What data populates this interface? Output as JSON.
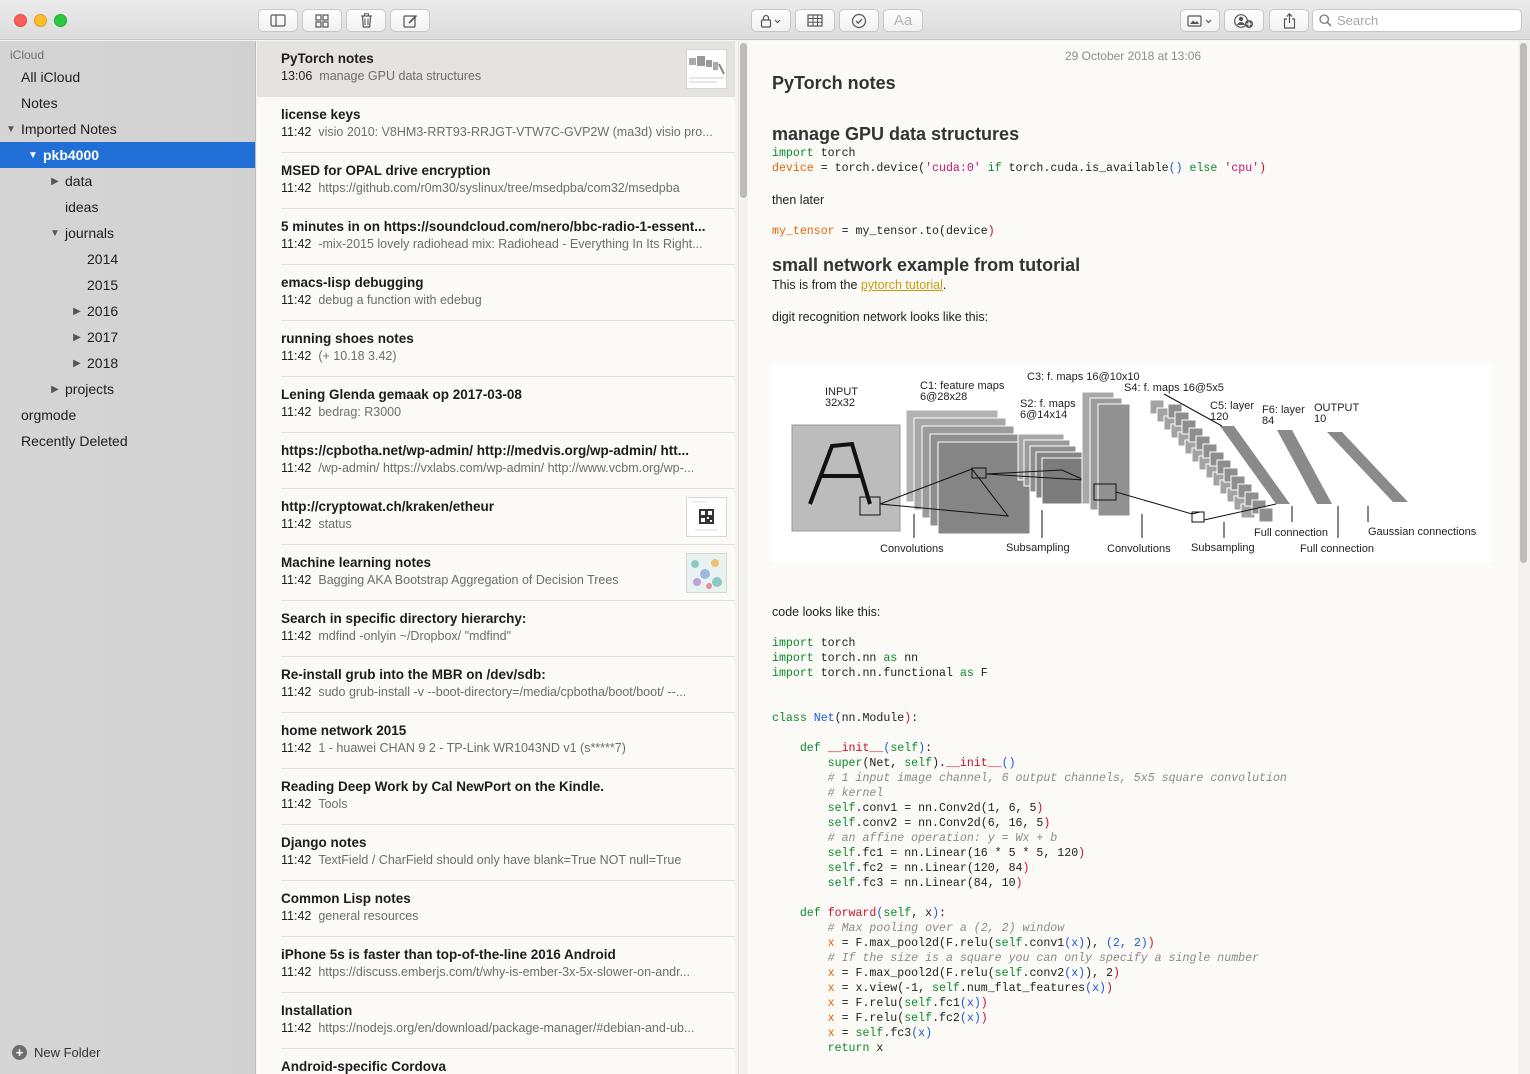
{
  "colors": {
    "selection_blue": "#1f6fd6",
    "keyword_green": "#0b8a2e",
    "variable_orange": "#e0670a",
    "string_magenta": "#c0137c",
    "link_gold": "#c99a10"
  },
  "toolbar": {
    "buttons": [
      {
        "name": "sidebar-toggle-icon"
      },
      {
        "name": "gallery-view-icon"
      },
      {
        "name": "trash-icon"
      },
      {
        "name": "compose-icon"
      },
      {
        "name": "lock-icon"
      },
      {
        "name": "table-icon"
      },
      {
        "name": "checklist-icon"
      },
      {
        "name": "format-icon",
        "label": "Aa"
      },
      {
        "name": "media-icon"
      },
      {
        "name": "add-people-icon"
      },
      {
        "name": "share-icon"
      }
    ],
    "search_placeholder": "Search"
  },
  "sidebar": {
    "header": "iCloud",
    "items": [
      {
        "label": "All iCloud",
        "indent": 0,
        "tri": ""
      },
      {
        "label": "Notes",
        "indent": 0,
        "tri": ""
      },
      {
        "label": "Imported Notes",
        "indent": 0,
        "tri": "▼"
      },
      {
        "label": "pkb4000",
        "indent": 1,
        "tri": "▼",
        "selected": true
      },
      {
        "label": "data",
        "indent": 2,
        "tri": "▶"
      },
      {
        "label": "ideas",
        "indent": 2,
        "tri": ""
      },
      {
        "label": "journals",
        "indent": 2,
        "tri": "▼"
      },
      {
        "label": "2014",
        "indent": 3,
        "tri": ""
      },
      {
        "label": "2015",
        "indent": 3,
        "tri": ""
      },
      {
        "label": "2016",
        "indent": 3,
        "tri": "▶"
      },
      {
        "label": "2017",
        "indent": 3,
        "tri": "▶"
      },
      {
        "label": "2018",
        "indent": 3,
        "tri": "▶"
      },
      {
        "label": "projects",
        "indent": 2,
        "tri": "▶"
      },
      {
        "label": "orgmode",
        "indent": 0,
        "tri": ""
      },
      {
        "label": "Recently Deleted",
        "indent": 0,
        "tri": ""
      }
    ],
    "new_folder": "New Folder"
  },
  "notes": [
    {
      "title": "PyTorch notes",
      "time": "13:06",
      "snippet": "manage GPU data structures",
      "thumb": "diagram"
    },
    {
      "title": "license keys",
      "time": "11:42",
      "snippet": "visio 2010: V8HM3-RRT93-RRJGT-VTW7C-GVP2W (ma3d) visio pro..."
    },
    {
      "title": "MSED for OPAL drive encryption",
      "time": "11:42",
      "snippet": "https://github.com/r0m30/syslinux/tree/msedpba/com32/msedpba"
    },
    {
      "title": "5 minutes in on https://soundcloud.com/nero/bbc-radio-1-essent...",
      "time": "11:42",
      "snippet": "-mix-2015 lovely radiohead mix: Radiohead - Everything In Its Right..."
    },
    {
      "title": "emacs-lisp debugging",
      "time": "11:42",
      "snippet": "debug a function with edebug"
    },
    {
      "title": "running shoes notes",
      "time": "11:42",
      "snippet": "(+ 10.18 3.42)"
    },
    {
      "title": "Lening Glenda gemaak op 2017-03-08",
      "time": "11:42",
      "snippet": "bedrag: R3000"
    },
    {
      "title": "https://cpbotha.net/wp-admin/ http://medvis.org/wp-admin/ htt...",
      "time": "11:42",
      "snippet": "/wp-admin/ https://vxlabs.com/wp-admin/ http://www.vcbm.org/wp-..."
    },
    {
      "title": "http://cryptowat.ch/kraken/etheur",
      "time": "11:42",
      "snippet": "status",
      "thumb": "qr"
    },
    {
      "title": "Machine learning notes",
      "time": "11:42",
      "snippet": "Bagging AKA Bootstrap Aggregation of Decision Trees",
      "thumb": "map"
    },
    {
      "title": "Search in specific directory hierarchy:",
      "time": "11:42",
      "snippet": "mdfind -onlyin ~/Dropbox/ \"mdfind\""
    },
    {
      "title": "Re-install grub into the MBR on /dev/sdb:",
      "time": "11:42",
      "snippet": "sudo grub-install -v --boot-directory=/media/cpbotha/boot/boot/ --..."
    },
    {
      "title": "home network 2015",
      "time": "11:42",
      "snippet": "1 - huawei CHAN 9 2 - TP-Link WR1043ND v1 (s*****7)"
    },
    {
      "title": "Reading Deep Work by Cal NewPort on the Kindle.",
      "time": "11:42",
      "snippet": "Tools"
    },
    {
      "title": "Django notes",
      "time": "11:42",
      "snippet": "TextField / CharField should only have blank=True NOT null=True"
    },
    {
      "title": "Common Lisp notes",
      "time": "11:42",
      "snippet": "general resources"
    },
    {
      "title": "iPhone 5s is faster than top-of-the-line 2016 Android",
      "time": "11:42",
      "snippet": "https://discuss.emberjs.com/t/why-is-ember-3x-5x-slower-on-andr..."
    },
    {
      "title": "Installation",
      "time": "11:42",
      "snippet": "https://nodejs.org/en/download/package-manager/#debian-and-ub..."
    },
    {
      "title": "Android-specific Cordova",
      "time": "",
      "snippet": ""
    }
  ],
  "editor": {
    "date": "29 October 2018 at 13:06",
    "title": "PyTorch notes",
    "h_gpu": "manage GPU data structures",
    "then_later": "then later",
    "h_network": "small network example from tutorial",
    "from_pre": "This is from the ",
    "from_link": "pytorch tutorial",
    "from_post": ".",
    "digit": "digit recognition network looks like this:",
    "code_looks": "code looks like this:",
    "diagram": {
      "input": "INPUT",
      "input_dim": "32x32",
      "c1": "C1: feature maps",
      "c1_dim": "6@28x28",
      "s2": "S2: f. maps",
      "s2_dim": "6@14x14",
      "c3": "C3: f. maps 16@10x10",
      "s4": "S4: f. maps 16@5x5",
      "c5": "C5: layer",
      "c5_dim": "120",
      "f6": "F6: layer",
      "f6_dim": "84",
      "output": "OUTPUT",
      "output_dim": "10",
      "conv1": "Convolutions",
      "sub1": "Subsampling",
      "conv2": "Convolutions",
      "sub2": "Subsampling",
      "full1": "Full connection",
      "full2": "Full connection",
      "gauss": "Gaussian connections"
    }
  }
}
